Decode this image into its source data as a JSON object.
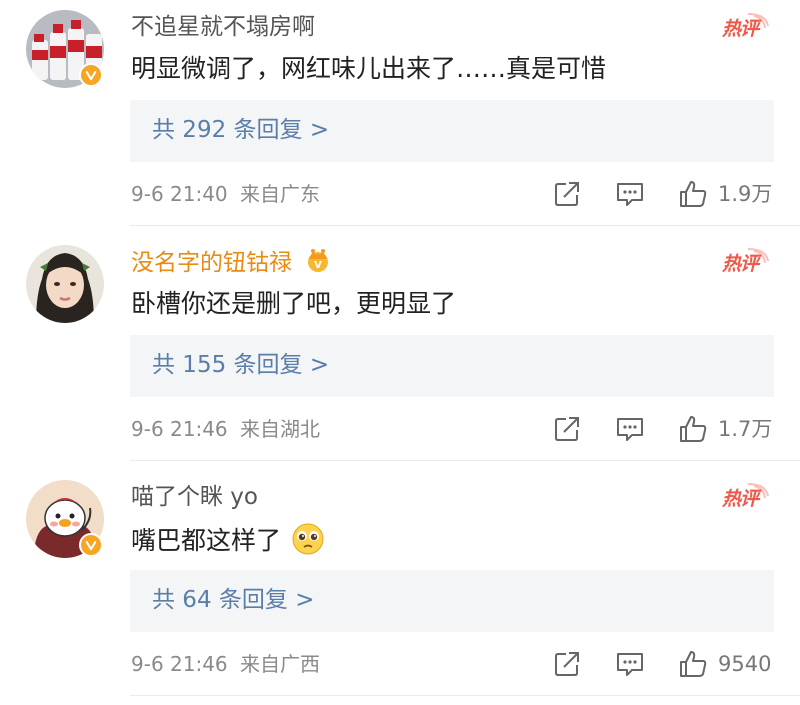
{
  "comments": [
    {
      "username": "不追星就不塌房啊",
      "hot_label": "热评",
      "text": "明显微调了，网红味儿出来了……真是可惜",
      "replies": "共 292 条回复 >",
      "time": "9-6 21:40",
      "location": "来自广东",
      "likes": "1.9万"
    },
    {
      "username": "没名字的钮钴禄",
      "hot_label": "热评",
      "text": "卧槽你还是删了吧，更明显了",
      "replies": "共 155 条回复 >",
      "time": "9-6 21:46",
      "location": "来自湖北",
      "likes": "1.7万"
    },
    {
      "username": "喵了个眯 yo",
      "hot_label": "热评",
      "text": "嘴巴都这样了",
      "replies": "共 64 条回复 >",
      "time": "9-6 21:46",
      "location": "来自广西",
      "likes": "9540"
    }
  ],
  "colors": {
    "reply_link": "#5a7ea8",
    "hot_tag": "#f0584a",
    "vip_name": "#e98a12",
    "verified_badge": "#f6a623"
  },
  "icons": [
    "verified-badge-icon",
    "crown-icon",
    "share-icon",
    "comment-icon",
    "like-icon",
    "pleading-face-emoji"
  ]
}
